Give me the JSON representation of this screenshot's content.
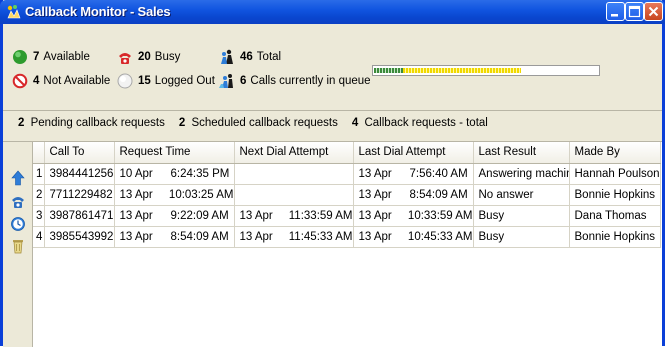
{
  "window": {
    "title": "Callback Monitor - Sales",
    "title_icon": "callback-monitor-icon"
  },
  "stats": {
    "available": {
      "count": "7",
      "label": "Available",
      "icon": "green-circle-icon",
      "color": "#2e9b2e"
    },
    "busy": {
      "count": "20",
      "label": "Busy",
      "icon": "busy-phone-icon",
      "color": "#d8282a"
    },
    "total": {
      "count": "46",
      "label": "Total",
      "icon": "people-icon"
    },
    "not_available": {
      "count": "4",
      "label": "Not Available",
      "icon": "no-entry-icon",
      "color": "#d8282a"
    },
    "logged_out": {
      "count": "15",
      "label": "Logged Out",
      "icon": "grey-circle-icon"
    },
    "queue": {
      "count": "6",
      "label": "Calls currently in queue",
      "icon": "queue-people-icon"
    }
  },
  "queue_bar": {
    "green_fraction": 0.13,
    "yellow_fraction": 0.52,
    "colors": {
      "green": "#3c8a3c",
      "yellow": "#f0d800"
    }
  },
  "summary": {
    "pending": {
      "count": "2",
      "label": "Pending callback requests"
    },
    "scheduled": {
      "count": "2",
      "label": "Scheduled callback requests"
    },
    "total": {
      "count": "4",
      "label": "Callback requests - total"
    }
  },
  "left_toolbar": [
    "move-up-icon",
    "callback-phone-icon",
    "clock-icon",
    "trash-icon"
  ],
  "table": {
    "headers": [
      "",
      "Call To",
      "Request Time",
      "Next Dial Attempt",
      "Last Dial Attempt",
      "Last Result",
      "Made By"
    ],
    "rows": [
      {
        "n": "1",
        "call_to": "3984441256",
        "req_date": "10 Apr",
        "req_time": "6:24:35 PM",
        "next_date": "",
        "next_time": "",
        "last_date": "13 Apr",
        "last_time": "7:56:40 AM",
        "result": "Answering machine",
        "made_by": "Hannah Poulson"
      },
      {
        "n": "2",
        "call_to": "7711229482",
        "req_date": "13 Apr",
        "req_time": "10:03:25 AM",
        "next_date": "",
        "next_time": "",
        "last_date": "13 Apr",
        "last_time": "8:54:09 AM",
        "result": "No answer",
        "made_by": "Bonnie Hopkins"
      },
      {
        "n": "3",
        "call_to": "3987861471",
        "req_date": "13 Apr",
        "req_time": "9:22:09 AM",
        "next_date": "13 Apr",
        "next_time": "11:33:59 AM",
        "last_date": "13 Apr",
        "last_time": "10:33:59 AM",
        "result": "Busy",
        "made_by": "Dana Thomas"
      },
      {
        "n": "4",
        "call_to": "3985543992",
        "req_date": "13 Apr",
        "req_time": "8:54:09 AM",
        "next_date": "13 Apr",
        "next_time": "11:45:33 AM",
        "last_date": "13 Apr",
        "last_time": "10:45:33 AM",
        "result": "Busy",
        "made_by": "Bonnie Hopkins"
      }
    ]
  }
}
